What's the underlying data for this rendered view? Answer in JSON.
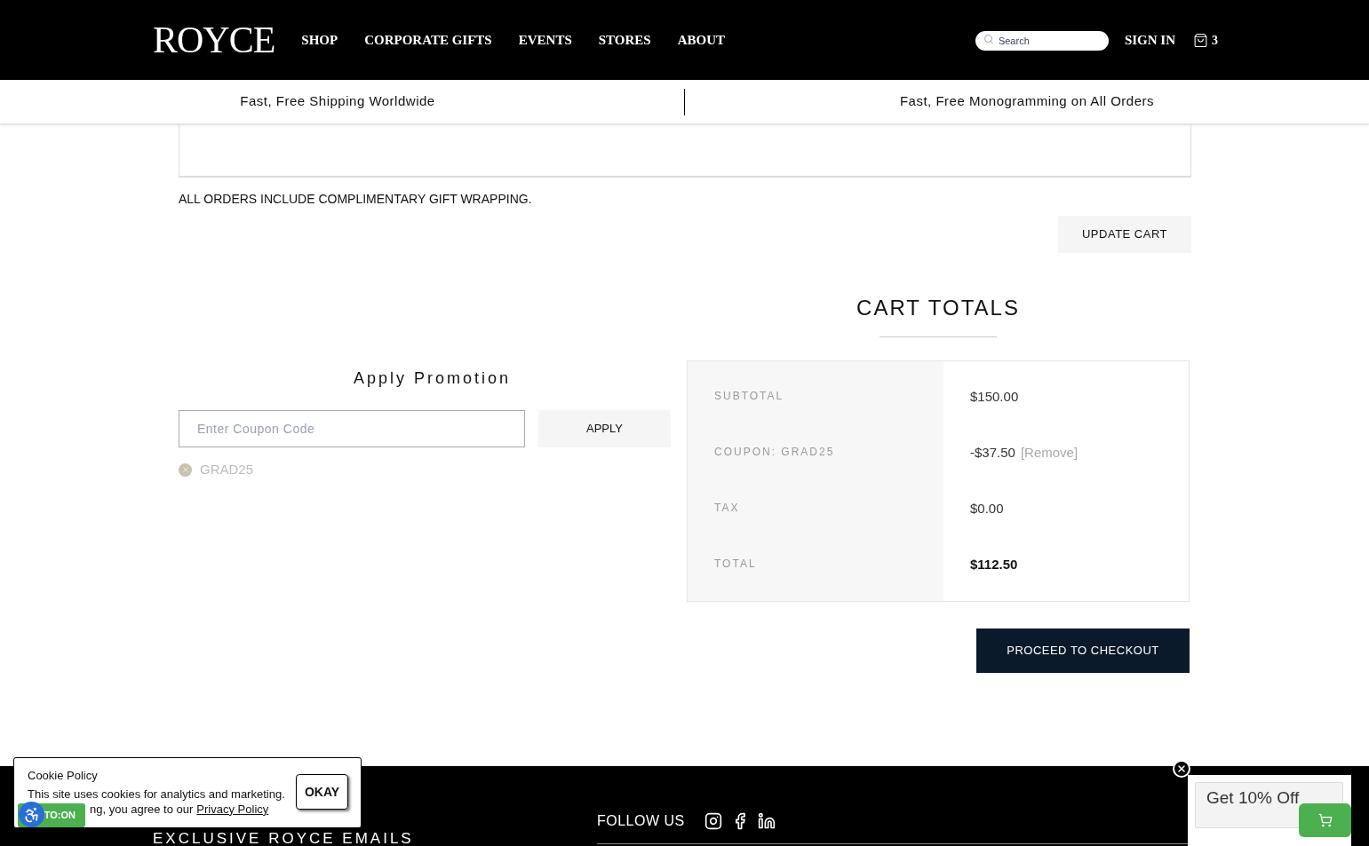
{
  "header": {
    "logo": "ROYCE",
    "nav": [
      "SHOP",
      "CORPORATE GIFTS",
      "EVENTS",
      "STORES",
      "ABOUT"
    ],
    "search": {
      "placeholder": "Search"
    },
    "sign_in": "SIGN IN",
    "cart_count": "3"
  },
  "banner": [
    "Fast, Free Shipping Worldwide",
    "Fast, Free Monogramming on All Orders"
  ],
  "gift_note": "ALL ORDERS INCLUDE COMPLIMENTARY GIFT WRAPPING.",
  "update_cart": "UPDATE CART",
  "promotion": {
    "title": "Apply Promotion",
    "coupon": {
      "placeholder": "Enter Coupon Code"
    },
    "apply": "APPLY",
    "applied": [
      "GRAD25"
    ]
  },
  "cart_totals": {
    "title": "CART TOTALS",
    "rows": [
      {
        "label": "SUBTOTAL",
        "value": "$150.00",
        "bold": false
      },
      {
        "label": "COUPON: GRAD25",
        "value": "-$37.50",
        "link": "[Remove]",
        "bold": false
      },
      {
        "label": "TAX",
        "value": "$0.00",
        "bold": false
      },
      {
        "label": "TOTAL",
        "value": "$112.50",
        "bold": true
      }
    ],
    "checkout": "PROCEED TO CHECKOUT"
  },
  "footer": {
    "newsletter_heading": "EXCLUSIVE ROYCE EMAILS",
    "follow_us": "FOLLOW US"
  },
  "cookie": {
    "title": "Cookie Policy",
    "line1": "This site uses cookies for analytics and marketing.",
    "line2": "ng, you agree to our",
    "link": "Privacy Policy",
    "button": "OKAY"
  },
  "accessibility": {
    "label": "TO:ON"
  },
  "discount": {
    "label": "Get 10% Off"
  }
}
